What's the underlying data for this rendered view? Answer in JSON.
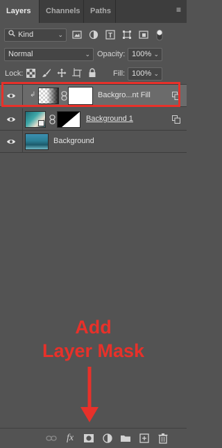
{
  "tabs": [
    {
      "label": "Layers"
    },
    {
      "label": "Channels"
    },
    {
      "label": "Paths"
    }
  ],
  "filter": {
    "kind_label": "Kind"
  },
  "blend": {
    "mode": "Normal",
    "opacity_label": "Opacity:",
    "opacity_value": "100%"
  },
  "lock": {
    "label": "Lock:",
    "fill_label": "Fill:",
    "fill_value": "100%"
  },
  "layers": [
    {
      "name": "Backgro...nt Fill",
      "selected": true
    },
    {
      "name": "Background 1",
      "selected": false
    },
    {
      "name": "Background",
      "selected": false
    }
  ],
  "annotation": {
    "line1": "Add",
    "line2": "Layer Mask",
    "color": "#e8312a"
  },
  "colors": {
    "panel": "#535353",
    "tabbar": "#3d3d3d",
    "selected": "#6b6b6b",
    "accent": "#e8312a"
  }
}
